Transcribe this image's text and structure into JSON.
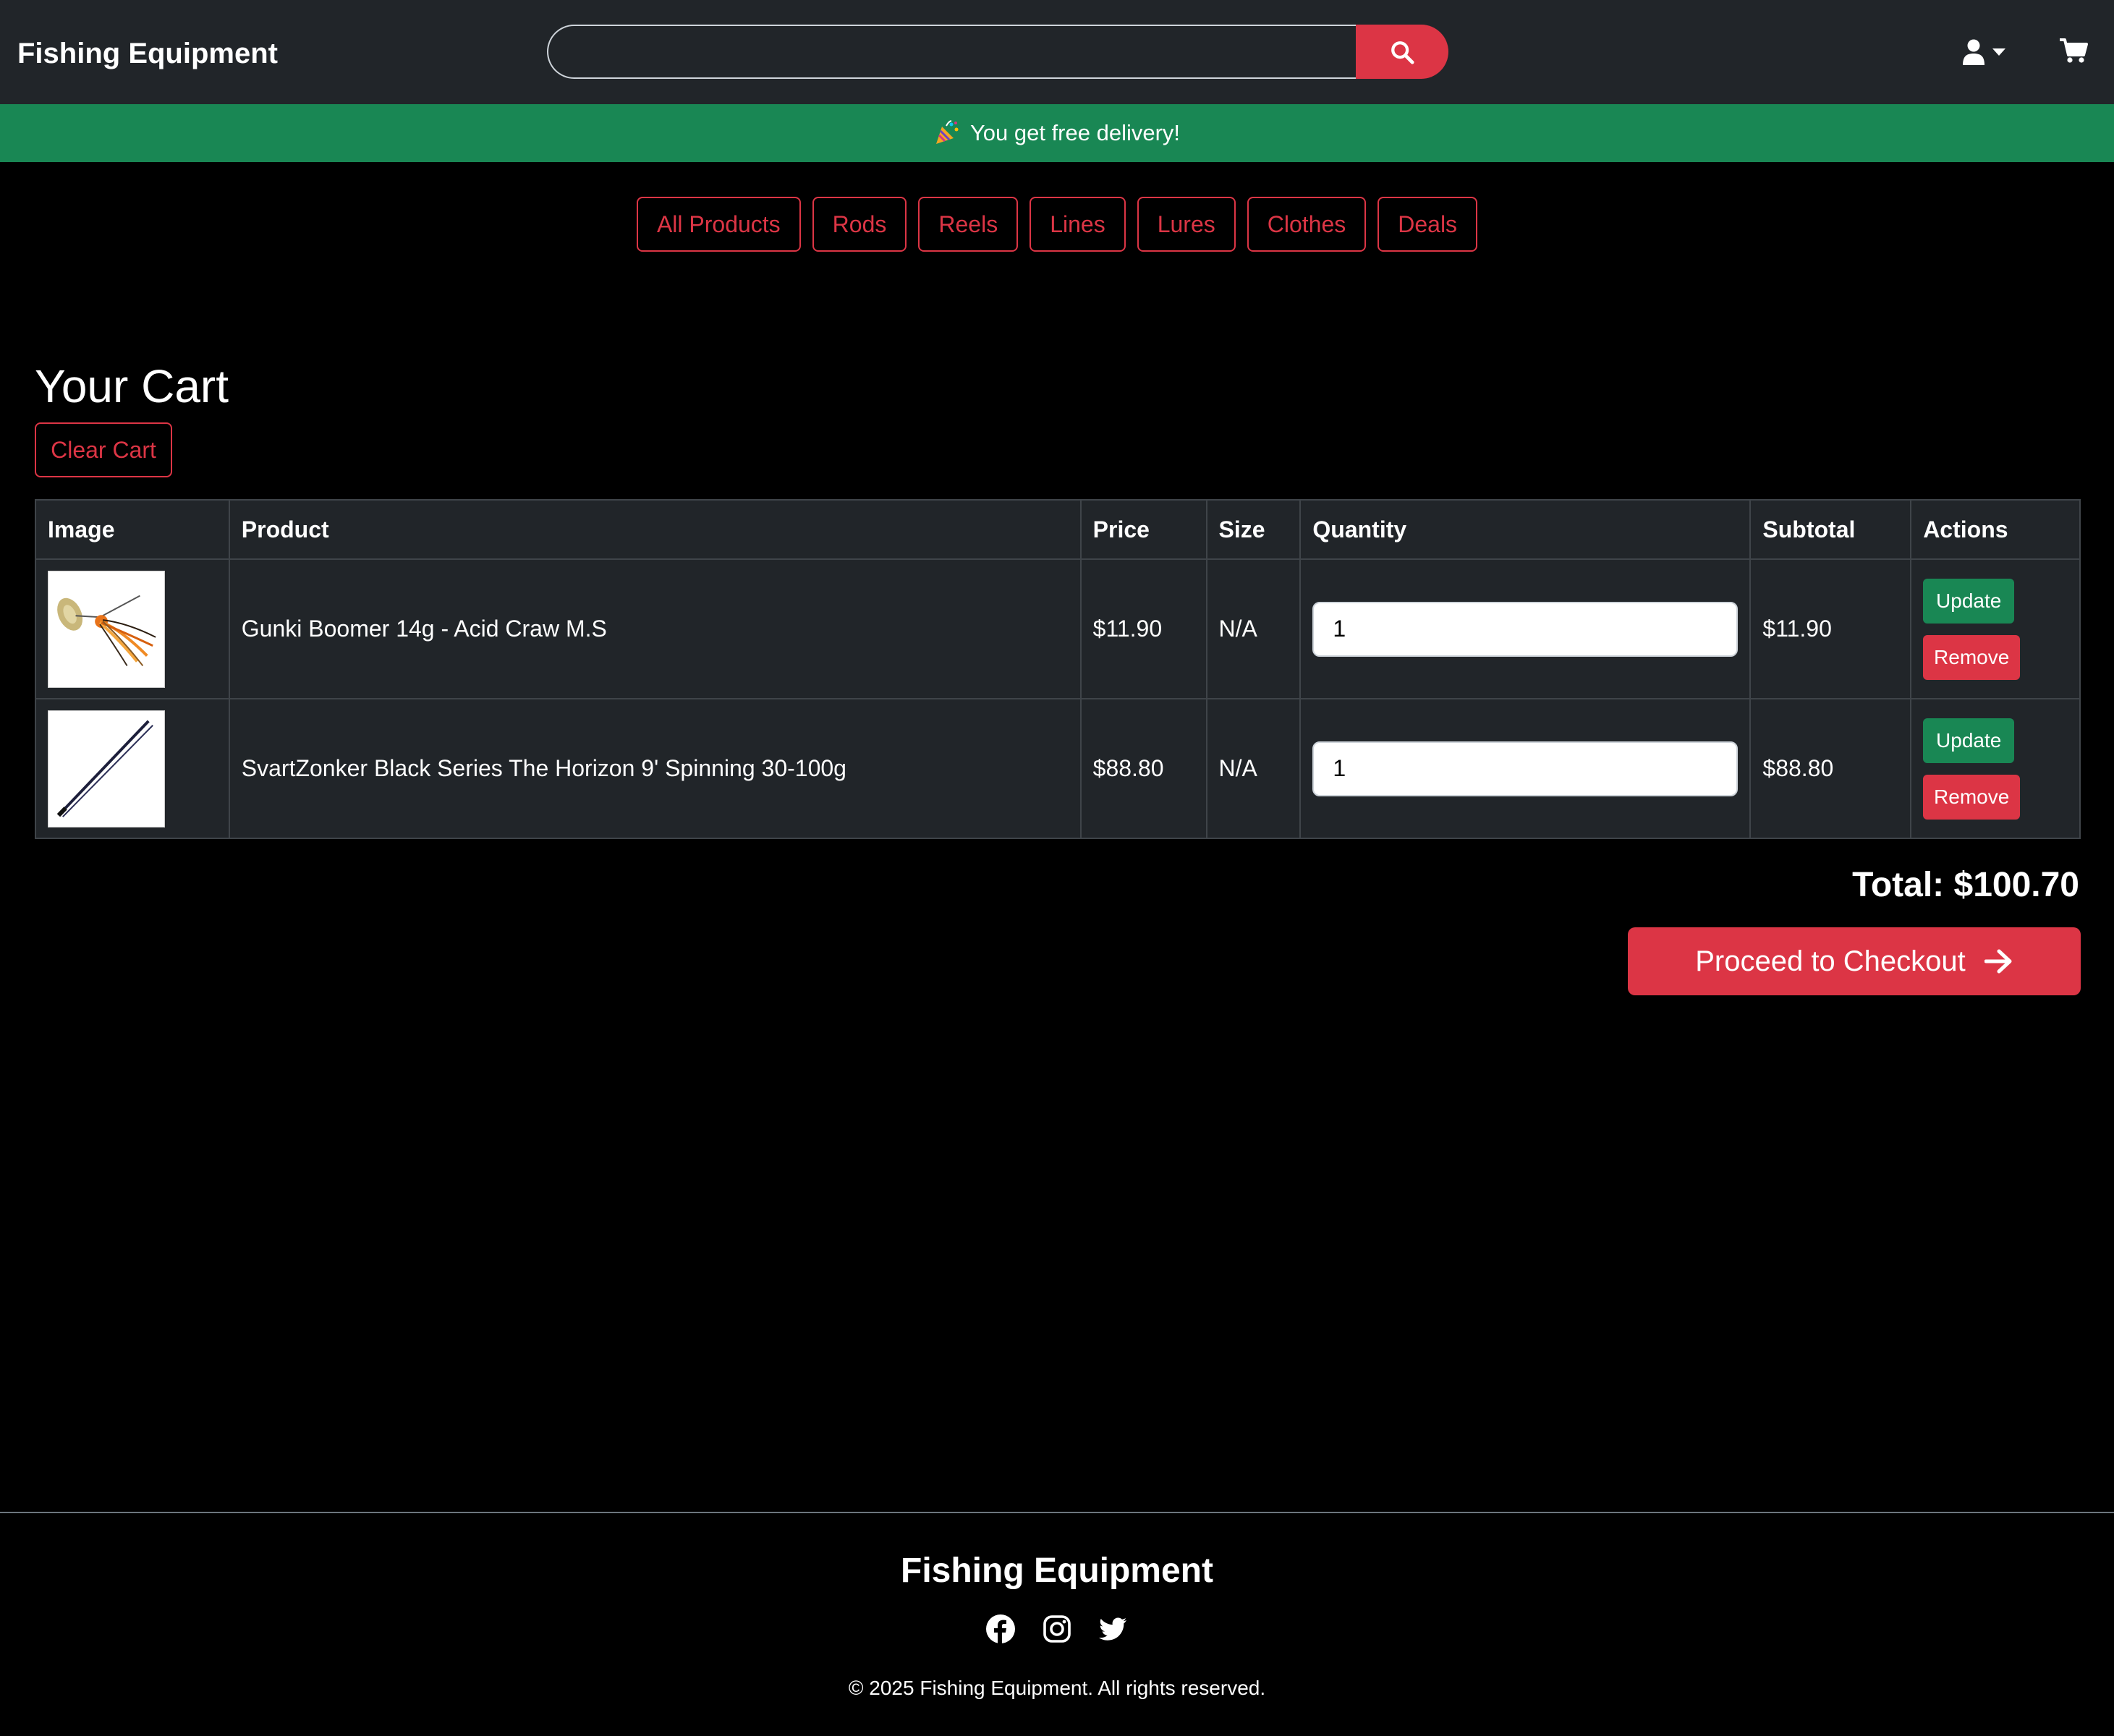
{
  "header": {
    "brand": "Fishing Equipment",
    "search_placeholder": "",
    "search_icon": "search-icon",
    "user_icon": "user-icon",
    "cart_icon": "cart-icon"
  },
  "banner": {
    "icon": "party-popper-icon",
    "text": "You get free delivery!"
  },
  "categories": [
    "All Products",
    "Rods",
    "Reels",
    "Lines",
    "Lures",
    "Clothes",
    "Deals"
  ],
  "cart": {
    "title": "Your Cart",
    "clear_label": "Clear Cart",
    "columns": [
      "Image",
      "Product",
      "Price",
      "Size",
      "Quantity",
      "Subtotal",
      "Actions"
    ],
    "rows": [
      {
        "image": "spinnerbait-lure-image",
        "product": "Gunki Boomer 14g - Acid Craw M.S",
        "price": "$11.90",
        "size": "N/A",
        "quantity": "1",
        "subtotal": "$11.90",
        "update_label": "Update",
        "remove_label": "Remove"
      },
      {
        "image": "spinning-rod-image",
        "product": "SvartZonker Black Series The Horizon 9' Spinning 30-100g",
        "price": "$88.80",
        "size": "N/A",
        "quantity": "1",
        "subtotal": "$88.80",
        "update_label": "Update",
        "remove_label": "Remove"
      }
    ],
    "total": "Total: $100.70",
    "checkout_label": "Proceed to Checkout"
  },
  "footer": {
    "brand": "Fishing Equipment",
    "social": [
      "facebook-icon",
      "instagram-icon",
      "twitter-icon"
    ],
    "copyright": "© 2025 Fishing Equipment. All rights reserved."
  },
  "colors": {
    "header_bg": "#212529",
    "banner_bg": "#198754",
    "accent_red": "#dc3545",
    "update_green": "#198754",
    "page_bg": "#000000"
  }
}
